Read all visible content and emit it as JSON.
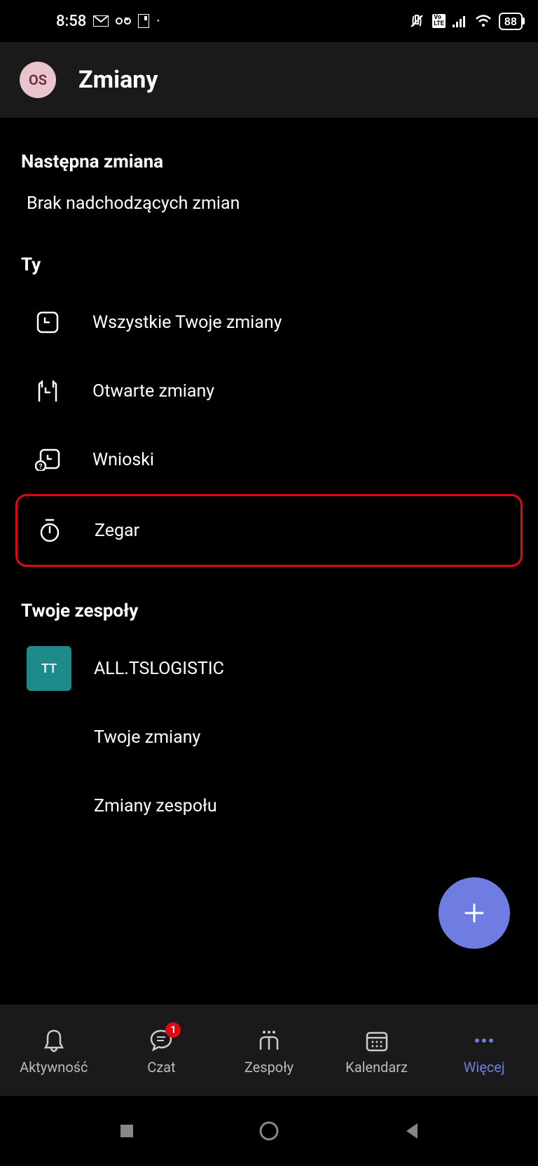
{
  "status": {
    "time": "8:58",
    "battery": "88"
  },
  "header": {
    "avatar_initials": "OS",
    "title": "Zmiany"
  },
  "next_shift": {
    "title": "Następna zmiana",
    "message": "Brak nadchodzących zmian"
  },
  "you_section": {
    "title": "Ty",
    "items": [
      {
        "label": "Wszystkie Twoje zmiany"
      },
      {
        "label": "Otwarte zmiany"
      },
      {
        "label": "Wnioski"
      },
      {
        "label": "Zegar"
      }
    ]
  },
  "teams_section": {
    "title": "Twoje zespoły",
    "team_initials": "TT",
    "team_name": "ALL.TSLOGISTIC",
    "sub_items": [
      {
        "label": "Twoje zmiany"
      },
      {
        "label": "Zmiany zespołu"
      }
    ]
  },
  "fab": {
    "label": "+"
  },
  "bottom_nav": {
    "items": [
      {
        "label": "Aktywność"
      },
      {
        "label": "Czat",
        "badge": "1"
      },
      {
        "label": "Zespoły"
      },
      {
        "label": "Kalendarz"
      },
      {
        "label": "Więcej"
      }
    ]
  }
}
